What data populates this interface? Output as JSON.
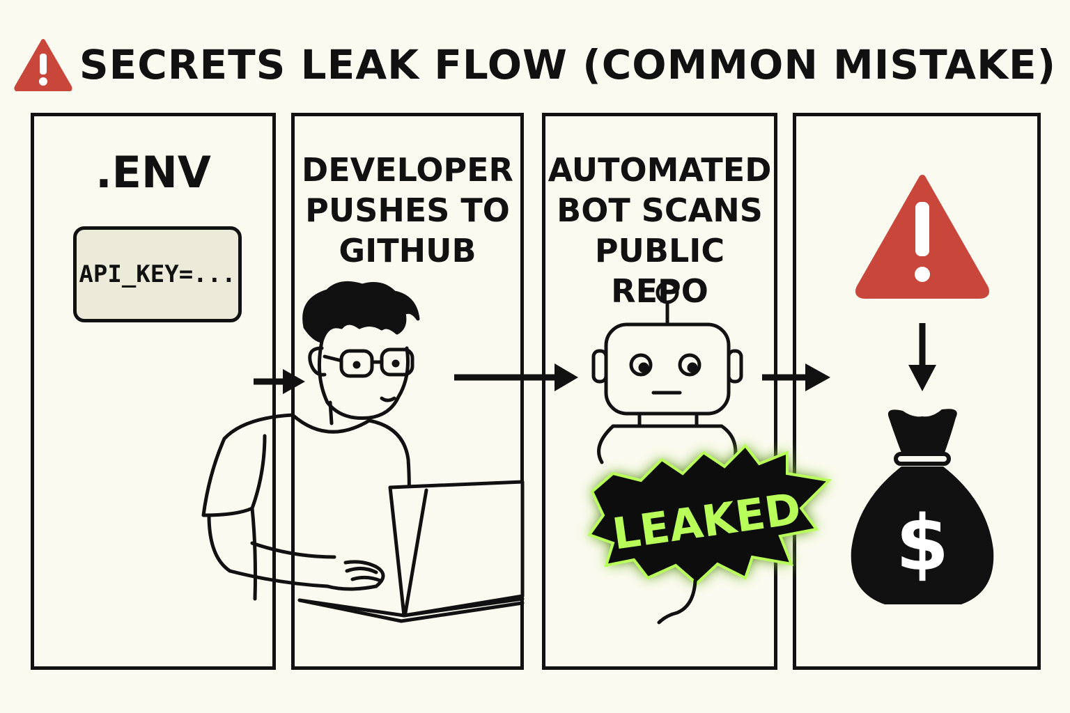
{
  "title": "SECRETS LEAK FLOW (COMMON MISTAKE)",
  "panels": [
    {
      "label": ".ENV",
      "code": "API_KEY=..."
    },
    {
      "label": "DEVELOPER PUSHES TO GITHUB"
    },
    {
      "label": "AUTOMATED BOT SCANS PUBLIC REPO",
      "badge": "LEAKED"
    },
    {
      "icon_top": "warning-icon",
      "icon_bottom": "money-bag-icon"
    }
  ],
  "colors": {
    "background": "#fbfaf1",
    "warning": "#c9473a",
    "leak_glow": "#b9ff5a",
    "ink": "#111111"
  }
}
